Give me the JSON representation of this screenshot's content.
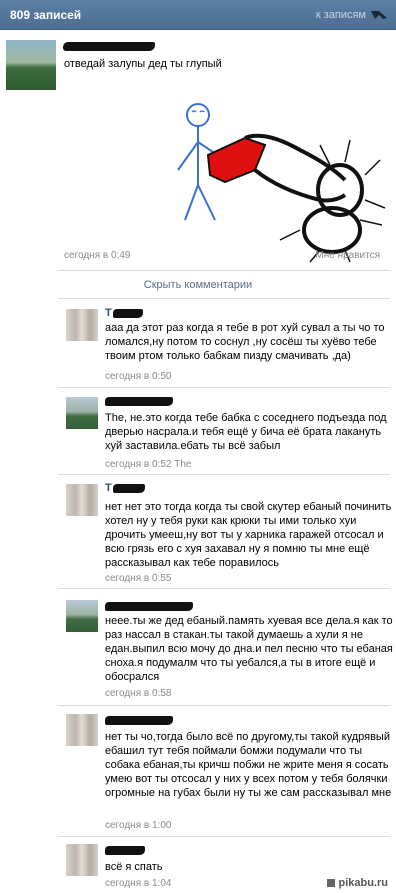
{
  "header": {
    "count": "809 записей",
    "back_label": "к записям"
  },
  "post": {
    "text": "отведай залупы дед ты глупый",
    "date": "сегодня в 0:49",
    "like": "Мне нравится"
  },
  "hide_comments": "Скрыть комментарии",
  "comments": [
    {
      "name_visible": "Т",
      "text": "ааа да этот раз когда я тебе в рот хуй сувал а ты чо то ломался,ну потом то соснул ,ну сосёш ты хуёво тебе твоим ртом только бабкам пизду смачивать ,да)",
      "date": "сегодня в 0:50"
    },
    {
      "name_visible": "",
      "text": "The, не.это когда тебе бабка с соседнего подъезда под дверью насрала.и тебя ещё у бича её брата лакануть хуй заставила.ебать ты всё забыл",
      "date": "сегодня в 0:52 The"
    },
    {
      "name_visible": "Т",
      "text": "нет нет это тогда когда ты свой скутер ебаный починить хотел ну у тебя руки как крюки ты ими только хуи дрочить умееш,ну вот ты у харника гаражей отсосал и всю грязь его с хуя захавал ну я помню ты мне ещё рассказывал как тебе поравилось",
      "date": "сегодня в 0:55"
    },
    {
      "name_visible": "",
      "text": "неее.ты же дед ебаный.память хуевая все дела.я как то раз нассал в стакан.ты такой думаешь а хули я не едан.выпил всю мочу до дна.и пел песню что ты ебаная сноха.я подумалм что ты уебался,а ты в итоге ещё и обосрался",
      "date": "сегодня в 0:58"
    },
    {
      "name_visible": "",
      "text": "нет ты чо,тогда было всё по другому,ты такой кудрявый ебашил тут тебя поймали бомжи подумали что ты собака ебаная,ты кричш побжи не жрите меня я сосать умею вот ты отсосал у них у всех потом у тебя болячки огромные на губах были ну ты же сам рассказывал мне",
      "date": "сегодня в 1:00"
    },
    {
      "name_visible": "",
      "text": "всё я спать",
      "date": "сегодня в 1:04"
    }
  ],
  "watermark": "pikabu.ru",
  "colors": {
    "header_bg": "#5d7ea3",
    "link": "#2b587a",
    "meta": "#8a8a8a",
    "drawing_fill": "#e01010"
  }
}
